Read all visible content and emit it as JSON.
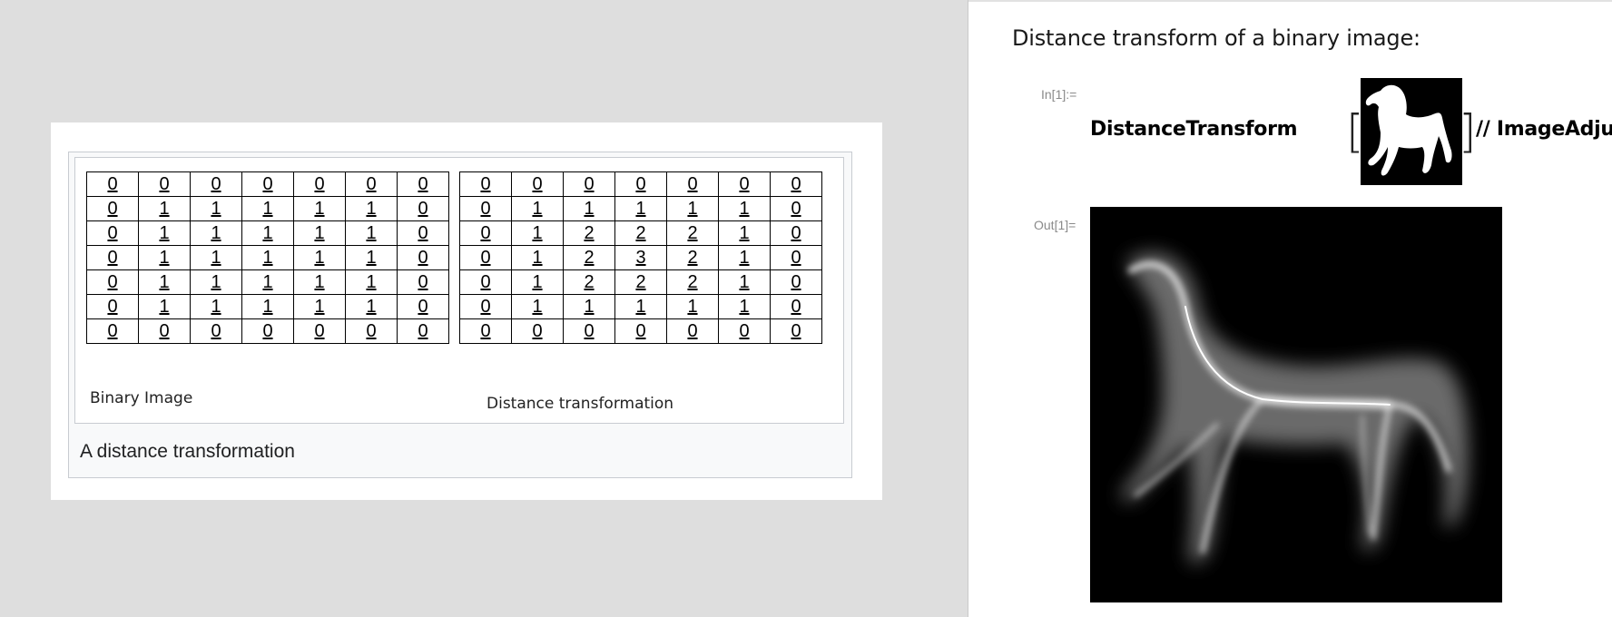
{
  "wiki_figure": {
    "binary_image": {
      "rows": [
        [
          "0",
          "0",
          "0",
          "0",
          "0",
          "0",
          "0"
        ],
        [
          "0",
          "1",
          "1",
          "1",
          "1",
          "1",
          "0"
        ],
        [
          "0",
          "1",
          "1",
          "1",
          "1",
          "1",
          "0"
        ],
        [
          "0",
          "1",
          "1",
          "1",
          "1",
          "1",
          "0"
        ],
        [
          "0",
          "1",
          "1",
          "1",
          "1",
          "1",
          "0"
        ],
        [
          "0",
          "1",
          "1",
          "1",
          "1",
          "1",
          "0"
        ],
        [
          "0",
          "0",
          "0",
          "0",
          "0",
          "0",
          "0"
        ]
      ],
      "label": "Binary Image"
    },
    "distance_transformation": {
      "rows": [
        [
          "0",
          "0",
          "0",
          "0",
          "0",
          "0",
          "0"
        ],
        [
          "0",
          "1",
          "1",
          "1",
          "1",
          "1",
          "0"
        ],
        [
          "0",
          "1",
          "2",
          "2",
          "2",
          "1",
          "0"
        ],
        [
          "0",
          "1",
          "2",
          "3",
          "2",
          "1",
          "0"
        ],
        [
          "0",
          "1",
          "2",
          "2",
          "2",
          "1",
          "0"
        ],
        [
          "0",
          "1",
          "1",
          "1",
          "1",
          "1",
          "0"
        ],
        [
          "0",
          "0",
          "0",
          "0",
          "0",
          "0",
          "0"
        ]
      ],
      "label": "Distance transformation"
    },
    "caption": "A distance transformation"
  },
  "notebook": {
    "text_cell": "Distance transform of a binary image:",
    "input_label": "In[1]:=",
    "function_name": "DistanceTransform",
    "postfix": "// ImageAdjust",
    "output_label": "Out[1]="
  }
}
